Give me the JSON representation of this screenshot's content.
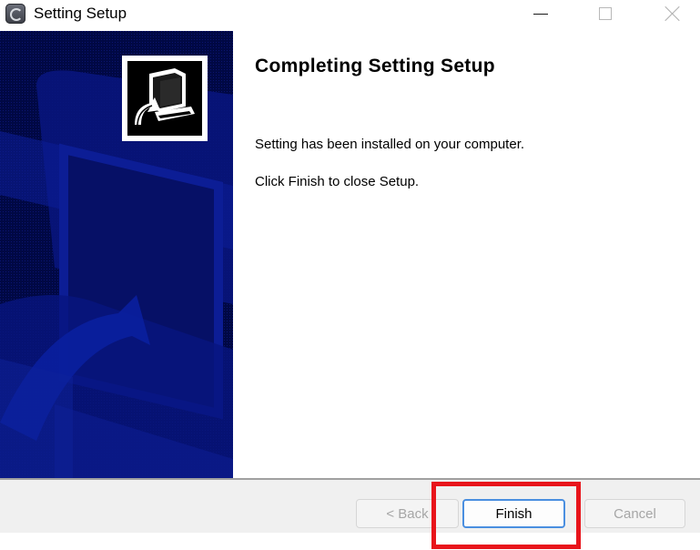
{
  "window": {
    "title": "Setting Setup",
    "icon": "installer-app-icon"
  },
  "title_bar_controls": {
    "minimize_icon": "minimize-icon",
    "maximize_icon": "maximize-icon",
    "close_icon": "close-icon"
  },
  "banner": {
    "logo_icon": "computer-install-icon",
    "background_color": "#000844",
    "pattern_color": "#0a1f96"
  },
  "content": {
    "heading": "Completing Setting Setup",
    "message": "Setting has been installed on your computer.",
    "instruction": "Click Finish to close Setup."
  },
  "footer": {
    "back_label": "< Back",
    "finish_label": "Finish",
    "cancel_label": "Cancel",
    "back_enabled": false,
    "cancel_enabled": false,
    "finish_focused": true
  },
  "annotation": {
    "highlight_color": "#e8141b",
    "highlight_target": "finish-button"
  }
}
